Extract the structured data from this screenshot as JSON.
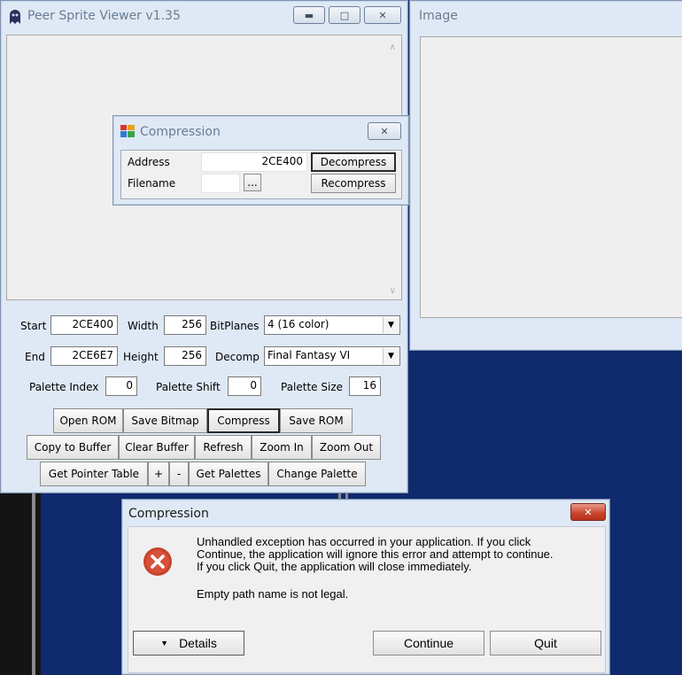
{
  "viewer": {
    "title": "Peer Sprite Viewer v1.35",
    "start_label": "Start",
    "start_value": "2CE400",
    "width_label": "Width",
    "width_value": "256",
    "bitplanes_label": "BitPlanes",
    "bitplanes_value": "4 (16 color)",
    "end_label": "End",
    "end_value": "2CE6E7",
    "height_label": "Height",
    "height_value": "256",
    "decomp_label": "Decomp",
    "decomp_value": "Final Fantasy VI",
    "palette_index_label": "Palette Index",
    "palette_index_value": "0",
    "palette_shift_label": "Palette Shift",
    "palette_shift_value": "0",
    "palette_size_label": "Palette Size",
    "palette_size_value": "16",
    "buttons_row1": [
      "Open ROM",
      "Save Bitmap",
      "Compress",
      "Save ROM"
    ],
    "buttons_row2": [
      "Copy to Buffer",
      "Clear Buffer",
      "Refresh",
      "Zoom In",
      "Zoom Out"
    ],
    "buttons_row3": [
      "Get Pointer Table",
      "+",
      "-",
      "Get Palettes",
      "Change Palette"
    ]
  },
  "image_window": {
    "title": "Image"
  },
  "compression_tool": {
    "title": "Compression",
    "address_label": "Address",
    "address_value": "2CE400",
    "filename_label": "Filename",
    "browse_label": "...",
    "decompress_label": "Decompress",
    "recompress_label": "Recompress"
  },
  "error_dialog": {
    "title": "Compression",
    "message_line1": "Unhandled exception has occurred in your application. If you click",
    "message_line2": "Continue, the application will ignore this error and attempt to continue.",
    "message_line3": "If you click Quit, the application will close immediately.",
    "detail": "Empty path name is not legal.",
    "details_label": "Details",
    "continue_label": "Continue",
    "quit_label": "Quit"
  },
  "icons": {
    "app": "ghost-icon",
    "tool": "window-icon",
    "error": "error-x-icon",
    "minimize": "minimize-icon",
    "maximize": "maximize-icon",
    "close": "close-icon"
  },
  "colors": {
    "desktop": "#102a6e",
    "error_red": "#c8432b"
  }
}
